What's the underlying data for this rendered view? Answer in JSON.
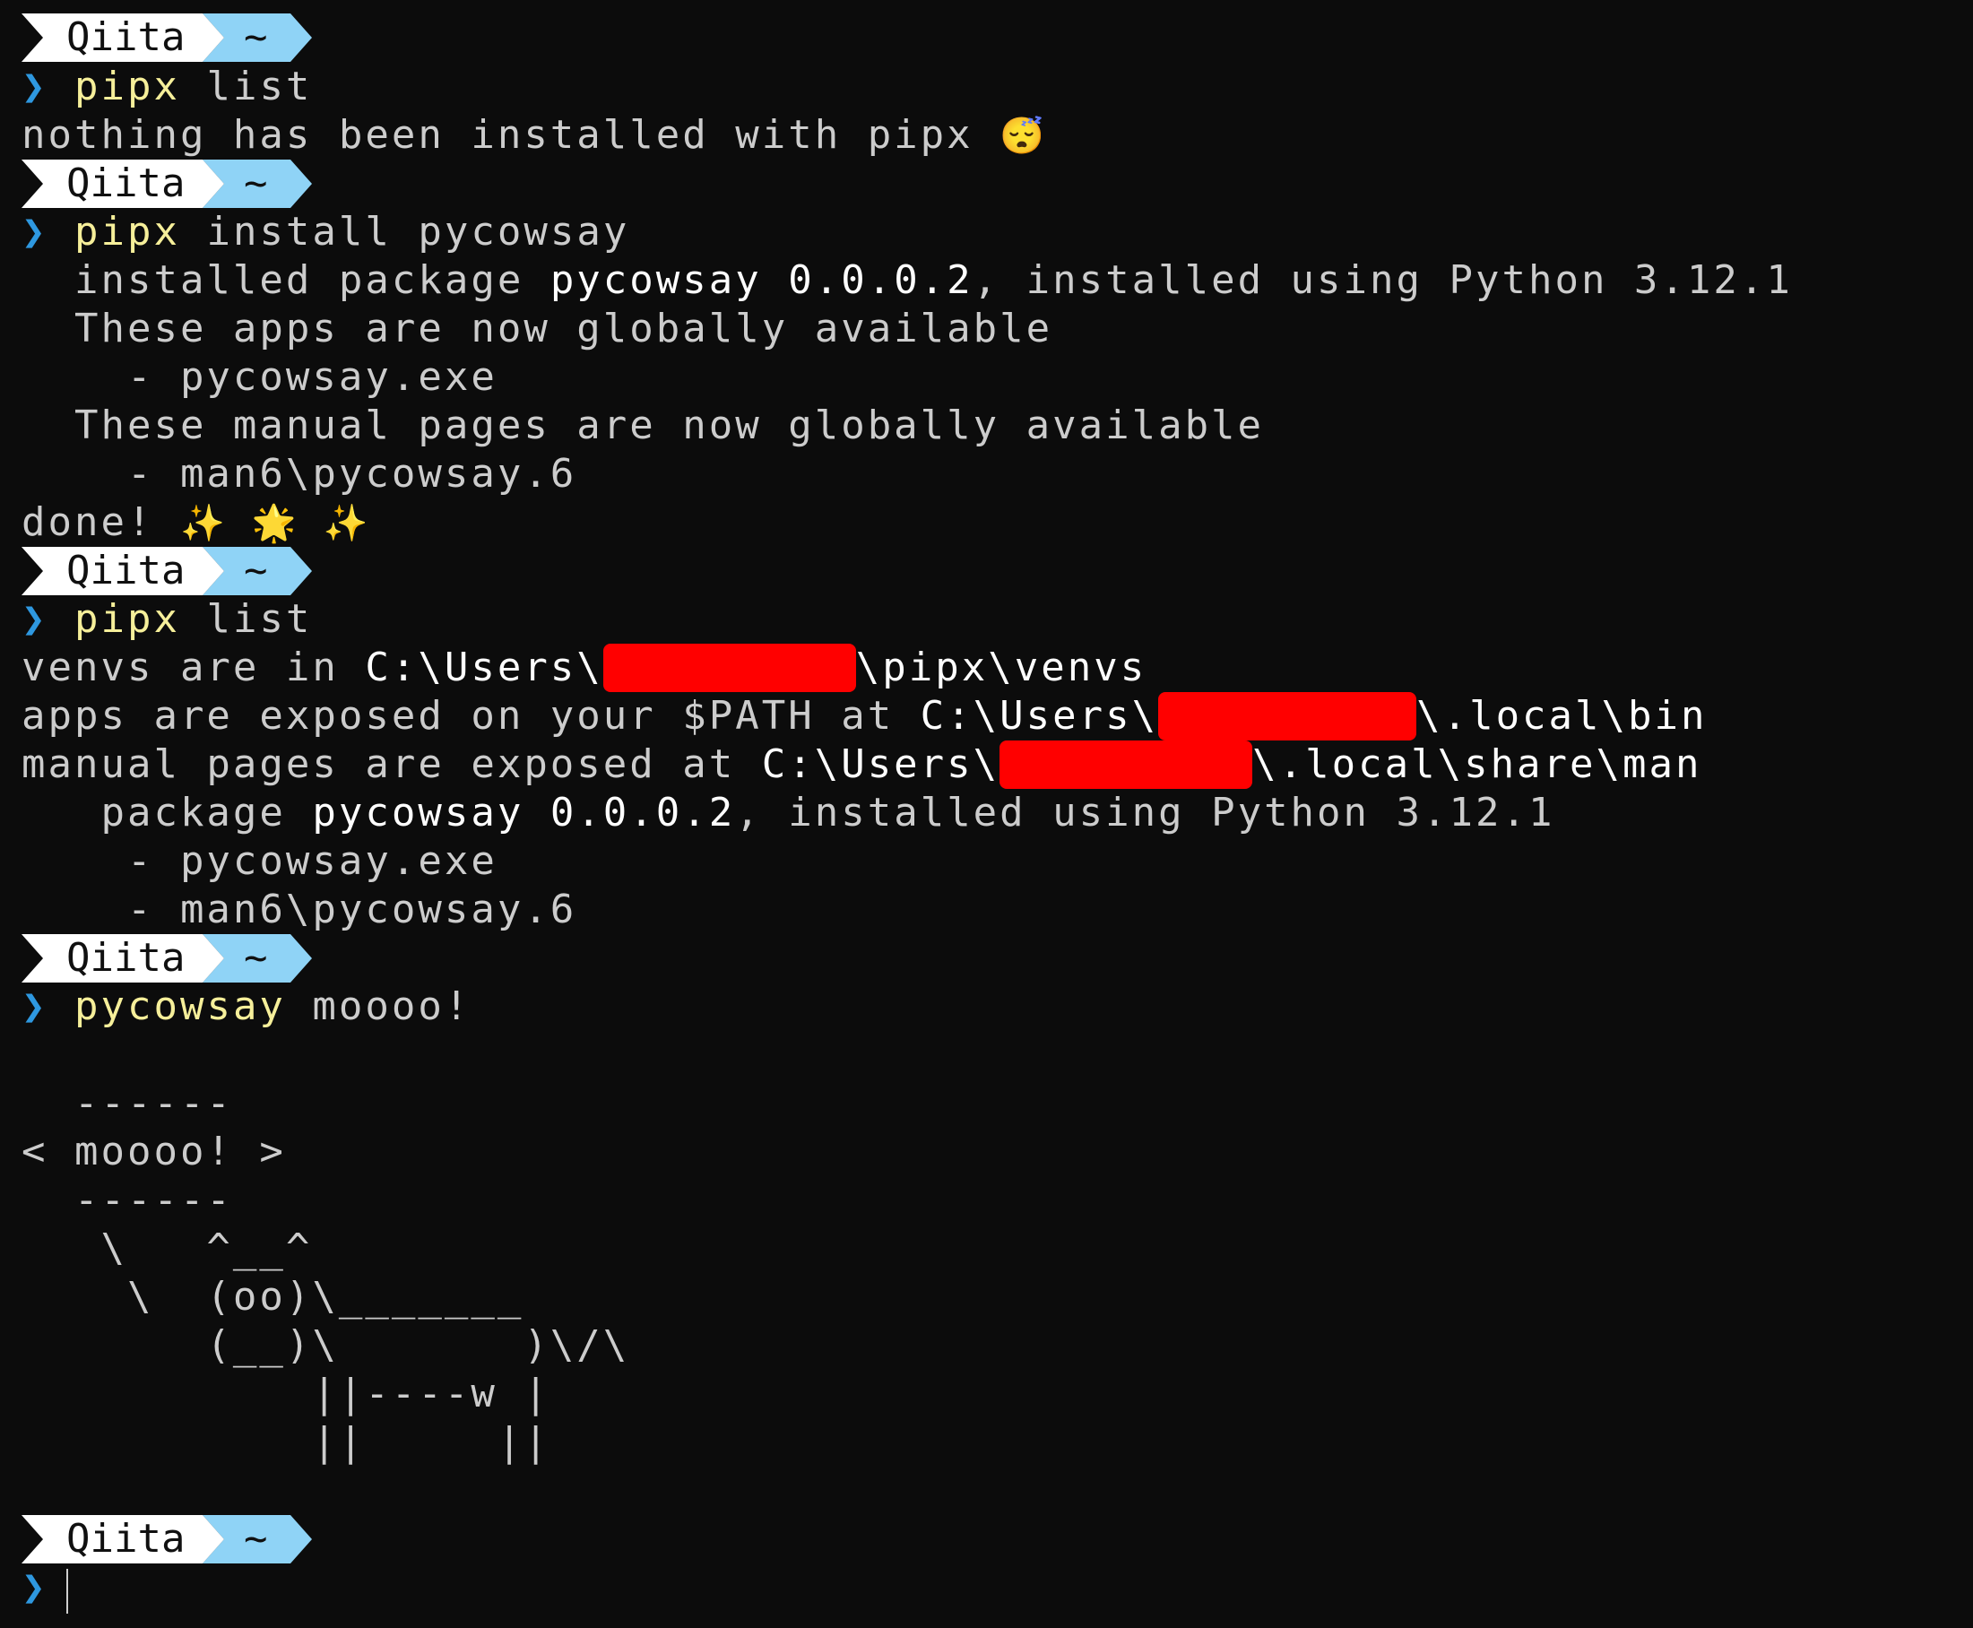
{
  "prompt": {
    "name": "Qiita",
    "dir": "~",
    "chevron": "❯"
  },
  "colors": {
    "background": "#0c0c0c",
    "text": "#cccccc",
    "command": "#f6ef9a",
    "chevron": "#2e98e0",
    "redaction": "#ff0000",
    "prompt_bg": "#ffffff",
    "prompt_dir_bg": "#8fd3f6"
  },
  "blocks": [
    {
      "command": {
        "exe": "pipx",
        "args": " list"
      },
      "output": {
        "l1": "nothing has been installed with pipx",
        "l1_emoji": "😴"
      }
    },
    {
      "command": {
        "exe": "pipx",
        "args": " install pycowsay"
      },
      "output": {
        "l1a": "  installed package ",
        "l1b": "pycowsay",
        "l1c": " ",
        "l1d": "0.0.0.2",
        "l1e": ", installed using Python 3.12.1",
        "l2": "  These apps are now globally available",
        "l3": "    - pycowsay.exe",
        "l4": "  These manual pages are now globally available",
        "l5": "    - man6\\pycowsay.6",
        "l6": "done! ",
        "l6_emoji": "✨ 🌟 ✨"
      }
    },
    {
      "command": {
        "exe": "pipx",
        "args": " list"
      },
      "output": {
        "venvs_a": "venvs are in ",
        "venvs_b": "C:\\Users\\",
        "venvs_c": "\\pipx\\venvs",
        "apps_a": "apps are exposed on your $PATH at ",
        "apps_b": "C:\\Users\\",
        "apps_c": "\\.local\\bin",
        "man_a": "manual pages are exposed at ",
        "man_b": "C:\\Users\\",
        "man_c": "\\.local\\share\\man",
        "pkg_a": "   package ",
        "pkg_b": "pycowsay",
        "pkg_c": " ",
        "pkg_d": "0.0.0.2",
        "pkg_e": ", installed using Python 3.12.1",
        "exe": "    - pycowsay.exe",
        "man6": "    - man6\\pycowsay.6"
      }
    },
    {
      "command": {
        "exe": "pycowsay",
        "args": " moooo!"
      },
      "output": {
        "c1": "  ------",
        "c2": "< moooo! >",
        "c3": "  ------",
        "c4": "   \\   ^__^",
        "c5": "    \\  (oo)\\_______",
        "c6": "       (__)\\       )\\/\\",
        "c7": "           ||----w |",
        "c8": "           ||     ||"
      }
    }
  ]
}
